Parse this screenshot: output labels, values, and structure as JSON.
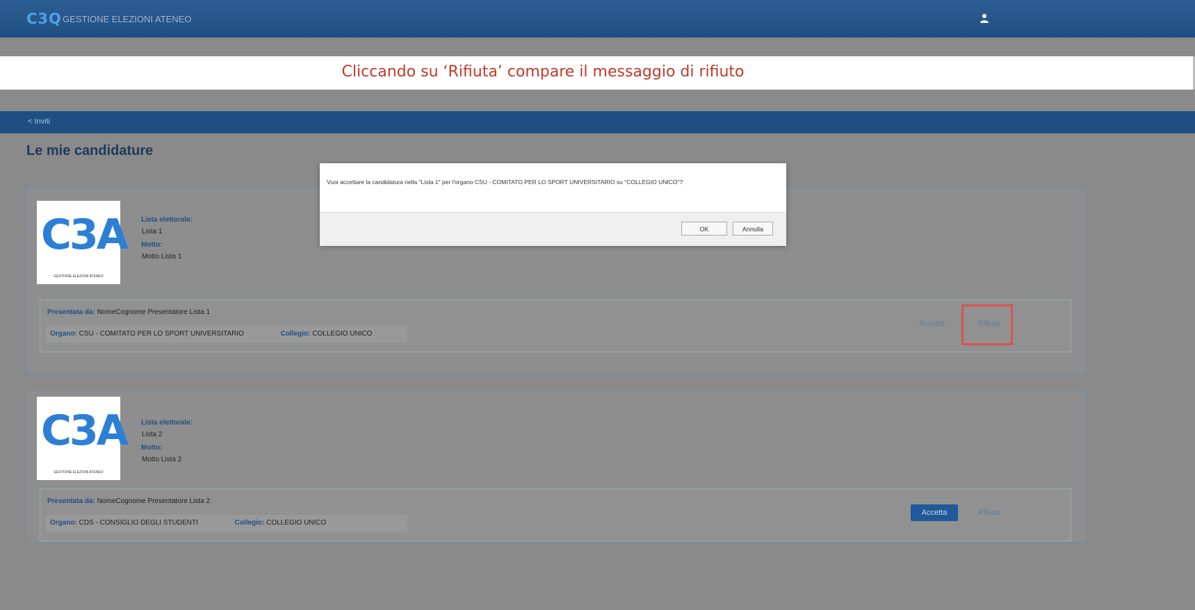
{
  "header": {
    "logo": "C3Q",
    "title": "GESTIONE ELEZIONI ATENEO",
    "user_icon": "user-icon"
  },
  "banner": {
    "text": "Cliccando su ‘Rifiuta’ compare il messaggio di rifiuto"
  },
  "breadcrumb": {
    "back_label": "< Inviti"
  },
  "page": {
    "title": "Le mie candidature"
  },
  "dialog": {
    "message": "Vuoi accettare la candidatura nella \"Lista 1\" per l'organo CSU - COMITATO PER LO SPORT UNIVERSITARIO su \"COLLEGIO UNICO\"?",
    "ok_label": "OK",
    "cancel_label": "Annulla"
  },
  "candidatures": [
    {
      "logo_mark": "C3A",
      "logo_sub": "GESTIONE ELEZIONI ATENEO",
      "lista_label": "Lista elettorale:",
      "lista_value": "Lista 1",
      "motto_label": "Motto:",
      "motto_value": "Motto Lista 1",
      "presentata_label": "Presentata da:",
      "presentata_value": "NomeCognome Presentatore Lista 1",
      "organo_label": "Organo:",
      "organo_value": "CSU - COMITATO PER LO SPORT UNIVERSITARIO",
      "collegio_label": "Collegio:",
      "collegio_value": "COLLEGIO UNICO",
      "accetta_label": "Accetta",
      "rifiuta_label": "Rifiuta"
    },
    {
      "logo_mark": "C3A",
      "logo_sub": "GESTIONE ELEZIONI ATENEO",
      "lista_label": "Lista elettorale:",
      "lista_value": "Lista 2",
      "motto_label": "Motto:",
      "motto_value": "Motto Lista 2",
      "presentata_label": "Presentata da:",
      "presentata_value": "NomeCognome Presentatore Lista 2",
      "organo_label": "Organo:",
      "organo_value": "CDS - CONSIGLIO DEGLI STUDENTI",
      "collegio_label": "Collegio:",
      "collegio_value": "COLLEGIO UNICO",
      "accetta_label": "Accetta",
      "rifiuta_label": "Rifiuta"
    }
  ],
  "colors": {
    "brand": "#1f4f82",
    "highlight": "#d9534f",
    "banner_text": "#c0392b"
  }
}
